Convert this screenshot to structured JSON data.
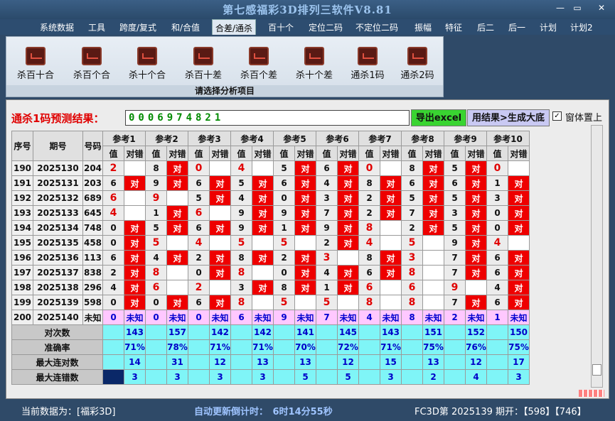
{
  "window": {
    "title": "第七感福彩3D排列三软件V8.81",
    "btn_min": "—",
    "btn_max": "▭",
    "btn_close": "✕"
  },
  "menu": [
    "系统数据",
    "工具",
    "跨度/复式",
    "和/合值",
    "合差/通杀",
    "百十个",
    "定位二码",
    "不定位二码",
    "振幅",
    "特征",
    "后二",
    "后一",
    "计划",
    "计划2"
  ],
  "ribbon": {
    "buttons": [
      "杀百十合",
      "杀百个合",
      "杀十个合",
      "杀百十差",
      "杀百个差",
      "杀十个差",
      "通杀1码",
      "通杀2码"
    ],
    "footer": "请选择分析项目",
    "icon": "chart-icon"
  },
  "pred": {
    "label": "通杀1码预测结果：",
    "value": "0006974821",
    "export": "导出excel",
    "generate": "用结果>生成大底",
    "pin_label": "窗体置上",
    "pin_checked": "✓"
  },
  "headers": {
    "seq": "序号",
    "issue": "期号",
    "num": "号码",
    "refs": [
      "参考1",
      "参考2",
      "参考3",
      "参考4",
      "参考5",
      "参考6",
      "参考7",
      "参考8",
      "参考9",
      "参考10"
    ],
    "val": "值",
    "cmp": "对错"
  },
  "rows": [
    {
      "seq": "190",
      "issue": "2025130",
      "num": "204",
      "refs": [
        [
          "2",
          0
        ],
        [
          "8",
          1
        ],
        [
          "0",
          0
        ],
        [
          "4",
          0
        ],
        [
          "5",
          1
        ],
        [
          "6",
          1
        ],
        [
          "0",
          0
        ],
        [
          "8",
          1
        ],
        [
          "5",
          1
        ],
        [
          "0",
          0
        ]
      ]
    },
    {
      "seq": "191",
      "issue": "2025131",
      "num": "203",
      "refs": [
        [
          "6",
          1
        ],
        [
          "9",
          1
        ],
        [
          "6",
          1
        ],
        [
          "5",
          1
        ],
        [
          "6",
          1
        ],
        [
          "4",
          1
        ],
        [
          "8",
          1
        ],
        [
          "6",
          1
        ],
        [
          "6",
          1
        ],
        [
          "1",
          1
        ]
      ]
    },
    {
      "seq": "192",
      "issue": "2025132",
      "num": "689",
      "refs": [
        [
          "6",
          0
        ],
        [
          "9",
          0
        ],
        [
          "5",
          1
        ],
        [
          "4",
          1
        ],
        [
          "0",
          1
        ],
        [
          "3",
          1
        ],
        [
          "2",
          1
        ],
        [
          "5",
          1
        ],
        [
          "5",
          1
        ],
        [
          "3",
          1
        ]
      ]
    },
    {
      "seq": "193",
      "issue": "2025133",
      "num": "645",
      "refs": [
        [
          "4",
          0
        ],
        [
          "1",
          1
        ],
        [
          "6",
          0
        ],
        [
          "9",
          1
        ],
        [
          "9",
          1
        ],
        [
          "7",
          1
        ],
        [
          "2",
          1
        ],
        [
          "7",
          1
        ],
        [
          "3",
          1
        ],
        [
          "0",
          1
        ]
      ]
    },
    {
      "seq": "194",
      "issue": "2025134",
      "num": "748",
      "refs": [
        [
          "0",
          1
        ],
        [
          "5",
          1
        ],
        [
          "6",
          1
        ],
        [
          "9",
          1
        ],
        [
          "1",
          1
        ],
        [
          "9",
          1
        ],
        [
          "8",
          0
        ],
        [
          "2",
          1
        ],
        [
          "5",
          1
        ],
        [
          "0",
          1
        ]
      ]
    },
    {
      "seq": "195",
      "issue": "2025135",
      "num": "458",
      "refs": [
        [
          "0",
          1
        ],
        [
          "5",
          0
        ],
        [
          "4",
          0
        ],
        [
          "5",
          0
        ],
        [
          "5",
          0
        ],
        [
          "2",
          1
        ],
        [
          "4",
          0
        ],
        [
          "5",
          0
        ],
        [
          "9",
          1
        ],
        [
          "4",
          0
        ]
      ]
    },
    {
      "seq": "196",
      "issue": "2025136",
      "num": "113",
      "refs": [
        [
          "6",
          1
        ],
        [
          "4",
          1
        ],
        [
          "2",
          1
        ],
        [
          "8",
          1
        ],
        [
          "2",
          1
        ],
        [
          "3",
          0
        ],
        [
          "8",
          1
        ],
        [
          "3",
          0
        ],
        [
          "7",
          1
        ],
        [
          "6",
          1
        ]
      ]
    },
    {
      "seq": "197",
      "issue": "2025137",
      "num": "838",
      "refs": [
        [
          "2",
          1
        ],
        [
          "8",
          0
        ],
        [
          "0",
          1
        ],
        [
          "8",
          0
        ],
        [
          "0",
          1
        ],
        [
          "4",
          1
        ],
        [
          "6",
          1
        ],
        [
          "8",
          0
        ],
        [
          "7",
          1
        ],
        [
          "6",
          1
        ]
      ]
    },
    {
      "seq": "198",
      "issue": "2025138",
      "num": "296",
      "refs": [
        [
          "4",
          1
        ],
        [
          "6",
          0
        ],
        [
          "2",
          0
        ],
        [
          "3",
          1
        ],
        [
          "8",
          1
        ],
        [
          "1",
          1
        ],
        [
          "6",
          0
        ],
        [
          "6",
          0
        ],
        [
          "9",
          0
        ],
        [
          "4",
          1
        ]
      ]
    },
    {
      "seq": "199",
      "issue": "2025139",
      "num": "598",
      "refs": [
        [
          "0",
          1
        ],
        [
          "0",
          1
        ],
        [
          "6",
          1
        ],
        [
          "8",
          0
        ],
        [
          "5",
          0
        ],
        [
          "5",
          0
        ],
        [
          "8",
          0
        ],
        [
          "8",
          0
        ],
        [
          "7",
          1
        ],
        [
          "6",
          1
        ]
      ]
    }
  ],
  "pred_row": {
    "seq": "200",
    "issue": "2025140",
    "num": "未知",
    "refs": [
      "0",
      "0",
      "0",
      "6",
      "9",
      "7",
      "4",
      "8",
      "2",
      "1"
    ],
    "unknown": "未知"
  },
  "stats": [
    {
      "label": "对次数",
      "values": [
        "143",
        "157",
        "142",
        "142",
        "141",
        "145",
        "143",
        "151",
        "152",
        "150"
      ]
    },
    {
      "label": "准确率",
      "values": [
        "71%",
        "78%",
        "71%",
        "71%",
        "70%",
        "72%",
        "71%",
        "75%",
        "76%",
        "75%"
      ]
    },
    {
      "label": "最大连对数",
      "values": [
        "14",
        "31",
        "12",
        "13",
        "13",
        "12",
        "15",
        "13",
        "12",
        "17"
      ]
    },
    {
      "label": "最大连错数",
      "values": [
        "3",
        "3",
        "3",
        "3",
        "5",
        "5",
        "3",
        "2",
        "4",
        "3"
      ]
    }
  ],
  "status": {
    "current": "当前数据为：[福彩3D]",
    "countdown": "自动更新倒计时：　6时14分55秒",
    "latest": "FC3D第 2025139 期开：【598】【746】"
  }
}
